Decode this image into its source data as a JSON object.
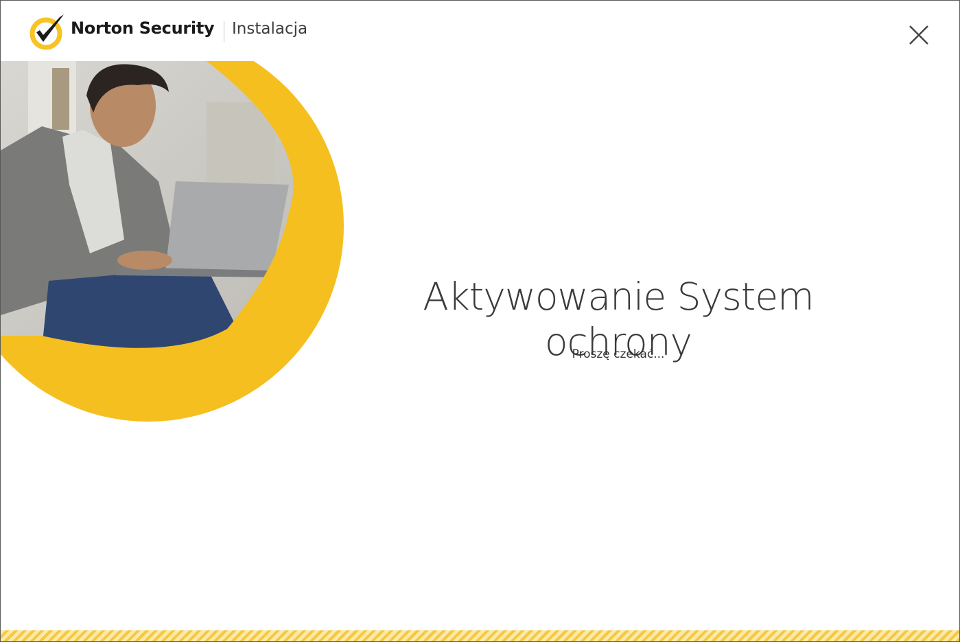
{
  "window": {
    "brand": "Norton Security",
    "subtitle": "Instalacja"
  },
  "main": {
    "title": "Aktywowanie System ochrony",
    "status": "Proszę czekać..."
  },
  "icons": {
    "logo": "norton-check-logo-icon",
    "close": "close-icon"
  },
  "colors": {
    "accent": "#f7c325",
    "progress": "#f5c842",
    "progress_light": "#fbe9a8"
  }
}
